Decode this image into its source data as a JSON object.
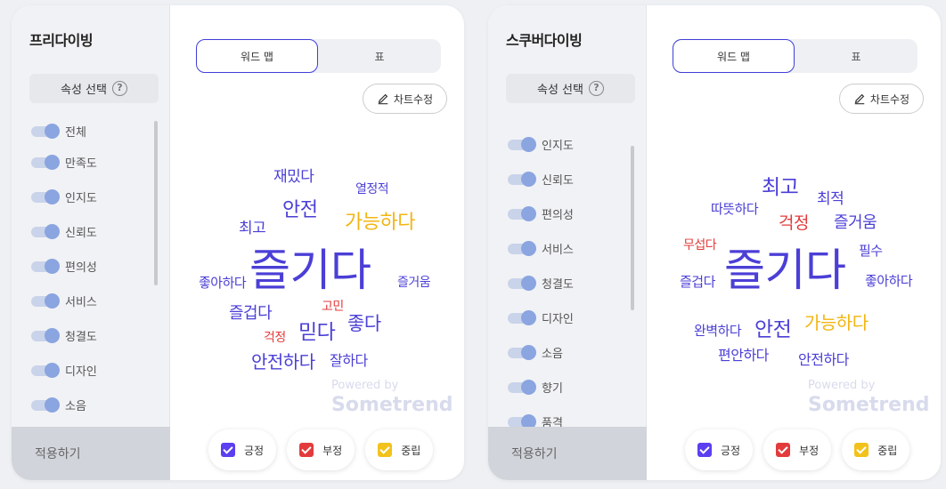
{
  "colors": {
    "positive": "#4b3fd6",
    "negative": "#e33b3b",
    "neutral": "#f2b512",
    "tab_border": "#3f3fd8"
  },
  "panels": [
    {
      "title": "프리다이빙",
      "attr_select": "속성 선택",
      "help_icon": "?",
      "attrs": [
        "전체",
        "만족도",
        "인지도",
        "신뢰도",
        "편의성",
        "서비스",
        "청결도",
        "디자인",
        "소음"
      ],
      "apply": "적용하기",
      "tabs": [
        "워드 맵",
        "표"
      ],
      "edit": "차트수정",
      "words": [
        {
          "text": "재밌다",
          "sentiment": "pos"
        },
        {
          "text": "열정적",
          "sentiment": "pos"
        },
        {
          "text": "안전",
          "sentiment": "pos"
        },
        {
          "text": "최고",
          "sentiment": "pos"
        },
        {
          "text": "가능하다",
          "sentiment": "neu"
        },
        {
          "text": "즐기다",
          "sentiment": "pos"
        },
        {
          "text": "좋아하다",
          "sentiment": "pos"
        },
        {
          "text": "즐거움",
          "sentiment": "pos"
        },
        {
          "text": "고민",
          "sentiment": "neg"
        },
        {
          "text": "즐겁다",
          "sentiment": "pos"
        },
        {
          "text": "좋다",
          "sentiment": "pos"
        },
        {
          "text": "믿다",
          "sentiment": "pos"
        },
        {
          "text": "걱정",
          "sentiment": "neg"
        },
        {
          "text": "안전하다",
          "sentiment": "pos"
        },
        {
          "text": "잘하다",
          "sentiment": "pos"
        }
      ],
      "powered": "Powered by",
      "brand": "Sometrend",
      "legend": [
        "긍정",
        "부정",
        "중립"
      ]
    },
    {
      "title": "스쿠버다이빙",
      "attr_select": "속성 선택",
      "help_icon": "?",
      "attrs": [
        "인지도",
        "신뢰도",
        "편의성",
        "서비스",
        "청결도",
        "디자인",
        "소음",
        "향기",
        "품격"
      ],
      "apply": "적용하기",
      "tabs": [
        "워드 맵",
        "표"
      ],
      "edit": "차트수정",
      "words": [
        {
          "text": "최고",
          "sentiment": "pos"
        },
        {
          "text": "최적",
          "sentiment": "pos"
        },
        {
          "text": "따뜻하다",
          "sentiment": "pos"
        },
        {
          "text": "걱정",
          "sentiment": "neg"
        },
        {
          "text": "즐거움",
          "sentiment": "pos"
        },
        {
          "text": "무섭다",
          "sentiment": "neg"
        },
        {
          "text": "필수",
          "sentiment": "pos"
        },
        {
          "text": "즐기다",
          "sentiment": "pos"
        },
        {
          "text": "즐겁다",
          "sentiment": "pos"
        },
        {
          "text": "좋아하다",
          "sentiment": "pos"
        },
        {
          "text": "완벽하다",
          "sentiment": "pos"
        },
        {
          "text": "안전",
          "sentiment": "pos"
        },
        {
          "text": "가능하다",
          "sentiment": "neu"
        },
        {
          "text": "편안하다",
          "sentiment": "pos"
        },
        {
          "text": "안전하다",
          "sentiment": "pos"
        }
      ],
      "powered": "Powered by",
      "brand": "Sometrend",
      "legend": [
        "긍정",
        "부정",
        "중립"
      ]
    }
  ]
}
